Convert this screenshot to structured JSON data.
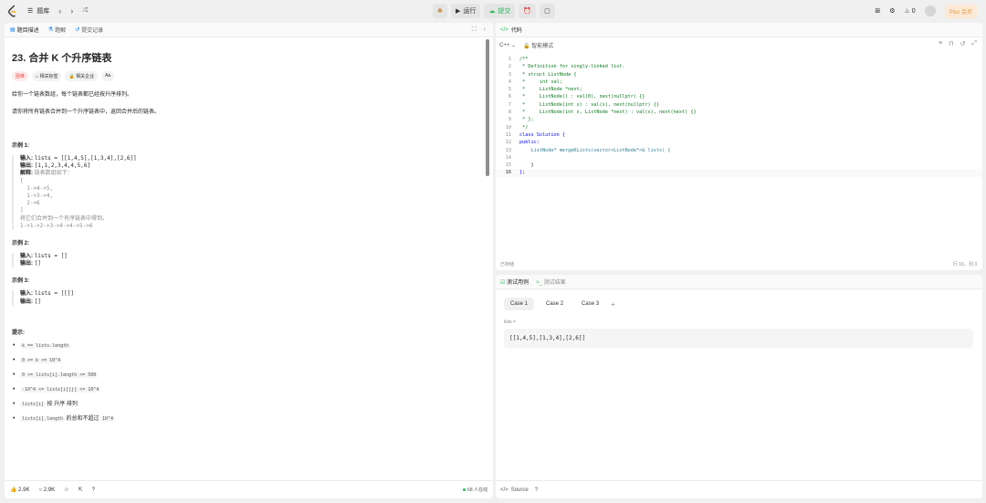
{
  "topbar": {
    "problem_list_label": "题库",
    "run_label": "运行",
    "submit_label": "提交",
    "streak_count": "0",
    "plus_label": "Plus 会员"
  },
  "left_tabs": {
    "description": "题目描述",
    "solutions": "题解",
    "submissions": "提交记录"
  },
  "problem": {
    "title": "23. 合并 K 个升序链表",
    "difficulty": "困难",
    "tags": [
      "相关标签",
      "相关企业",
      "Aa"
    ],
    "desc1": "给你一个链表数组，每个链表都已经按升序排列。",
    "desc2": "请你将所有链表合并到一个升序链表中，返回合并后的链表。"
  },
  "examples": [
    {
      "title": "示例 1:",
      "input_label": "输入:",
      "input": "lists = [[1,4,5],[1,3,4],[2,6]]",
      "output_label": "输出:",
      "output": "[1,1,2,3,4,4,5,6]",
      "expl_label": "解释:",
      "expl": "链表数组如下：",
      "expl_lines": [
        "[",
        "  1->4->5,",
        "  1->3->4,",
        "  2->6",
        "]"
      ],
      "expl_after": "将它们合并到一个有序链表中得到。",
      "expl_result": "1->1->2->3->4->4->5->6"
    },
    {
      "title": "示例 2:",
      "input_label": "输入:",
      "input": "lists = []",
      "output_label": "输出:",
      "output": "[]"
    },
    {
      "title": "示例 3:",
      "input_label": "输入:",
      "input": "lists = [[]]",
      "output_label": "输出:",
      "output": "[]"
    }
  ],
  "hints": {
    "title": "提示:",
    "items": [
      "k == lists.length",
      "0 <= k <= 10^4",
      "0 <= lists[i].length <= 500",
      "-10^4 <= lists[i][j] <= 10^4",
      "按 升序 排列",
      "的总和不超过"
    ],
    "chip5": "lists[i]",
    "chip6a": "lists[i].length",
    "chip6b": "10^4"
  },
  "left_footer": {
    "likes": "2.9K",
    "comments": "2.9K",
    "online": "68 人在线"
  },
  "code": {
    "title": "代码",
    "lang": "C++",
    "mode": "智能模式",
    "lines": [
      "/**",
      " * Definition for singly-linked list.",
      " * struct ListNode {",
      " *     int val;",
      " *     ListNode *next;",
      " *     ListNode() : val(0), next(nullptr) {}",
      " *     ListNode(int x) : val(x), next(nullptr) {}",
      " *     ListNode(int x, ListNode *next) : val(x), next(next) {}",
      " * };",
      " */",
      "class Solution {",
      "public:",
      "    ListNode* mergeKLists(vector<ListNode*>& lists) {",
      "",
      "    }",
      "};"
    ],
    "numbers": [
      "1",
      "2",
      "3",
      "4",
      "5",
      "6",
      "7",
      "8",
      "9",
      "10",
      "11",
      "12",
      "13",
      "14",
      "15",
      "16"
    ],
    "saved": "已存储",
    "position": "行 16，列 3"
  },
  "test": {
    "tab_cases": "测试用例",
    "tab_result": "测试结果",
    "cases": [
      "Case 1",
      "Case 2",
      "Case 3"
    ],
    "add": "+",
    "var_label": "lists =",
    "input_value": "[[1,4,5],[1,3,4],[2,6]]",
    "source": "Source"
  }
}
